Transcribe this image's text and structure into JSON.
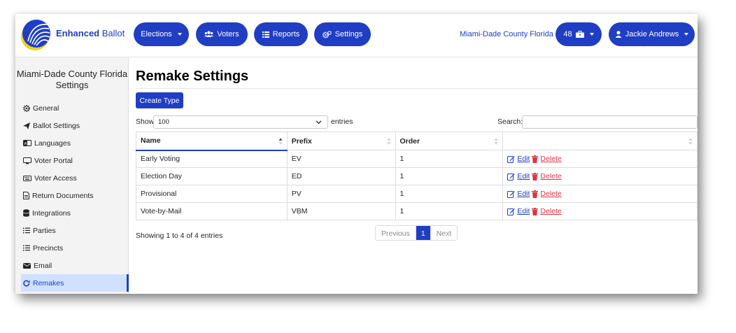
{
  "brand": {
    "bold": "Enhanced",
    "rest": "Ballot"
  },
  "nav": {
    "elections": "Elections",
    "voters": "Voters",
    "reports": "Reports",
    "settings": "Settings",
    "county": "Miami-Dade County Florida",
    "badge_count": "48",
    "user": "Jackie Andrews"
  },
  "sidebar": {
    "title_line1": "Miami-Dade County Florida",
    "title_line2": "Settings",
    "items": [
      {
        "label": "General",
        "icon": "gear-icon"
      },
      {
        "label": "Ballot Settings",
        "icon": "paper-plane-icon"
      },
      {
        "label": "Languages",
        "icon": "language-icon"
      },
      {
        "label": "Voter Portal",
        "icon": "desktop-icon"
      },
      {
        "label": "Voter Access",
        "icon": "keyboard-icon"
      },
      {
        "label": "Return Documents",
        "icon": "document-icon"
      },
      {
        "label": "Integrations",
        "icon": "database-icon"
      },
      {
        "label": "Parties",
        "icon": "list-icon"
      },
      {
        "label": "Precincts",
        "icon": "list-icon"
      },
      {
        "label": "Email",
        "icon": "envelope-icon"
      },
      {
        "label": "Remakes",
        "icon": "redo-icon",
        "active": true
      }
    ]
  },
  "main": {
    "title": "Remake Settings",
    "create_button": "Create Type",
    "show_label": "Show",
    "show_value": "100",
    "entries_label": "entries",
    "search_label": "Search:",
    "columns": [
      "Name",
      "Prefix",
      "Order",
      ""
    ],
    "rows": [
      {
        "name": "Early Voting",
        "prefix": "EV",
        "order": "1"
      },
      {
        "name": "Election Day",
        "prefix": "ED",
        "order": "1"
      },
      {
        "name": "Provisional",
        "prefix": "PV",
        "order": "1"
      },
      {
        "name": "Vote-by-Mail",
        "prefix": "VBM",
        "order": "1"
      }
    ],
    "edit_label": "Edit",
    "delete_label": "Delete",
    "info": "Showing 1 to 4 of 4 entries",
    "pager": {
      "previous": "Previous",
      "current": "1",
      "next": "Next"
    }
  },
  "colors": {
    "primary": "#1f3ec4",
    "danger": "#dc3545",
    "sidebar_bg": "#f3f3f3",
    "active_bg": "#cfe1ff"
  }
}
